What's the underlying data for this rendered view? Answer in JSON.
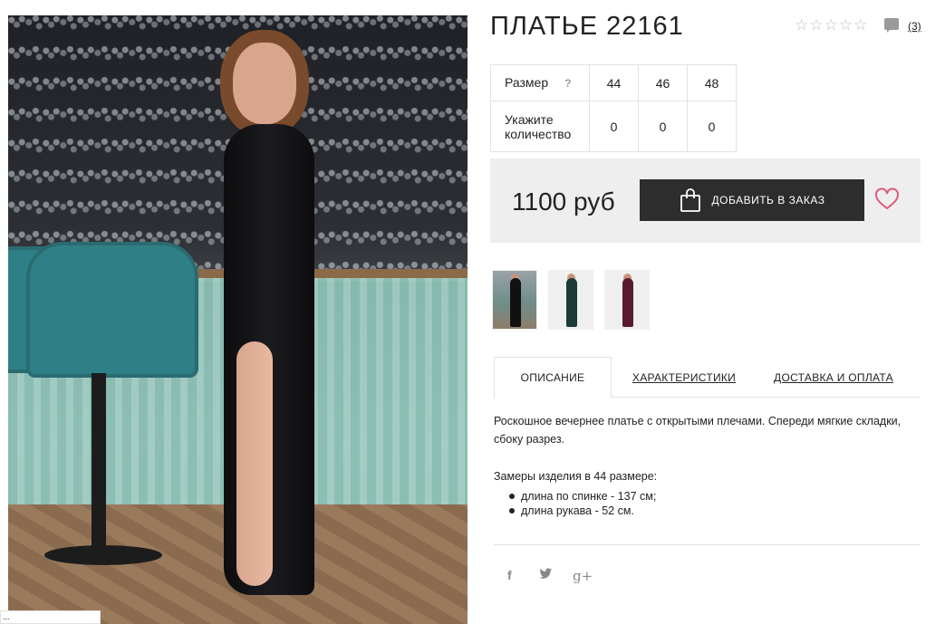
{
  "product": {
    "title": "ПЛАТЬЕ 22161",
    "rating_stars": 5,
    "rating_value": 0,
    "reviews_count": "(3)"
  },
  "size_table": {
    "size_label": "Размер",
    "help_mark": "?",
    "sizes": [
      "44",
      "46",
      "48"
    ],
    "qty_label": "Укажите количество",
    "quantities": [
      "0",
      "0",
      "0"
    ]
  },
  "purchase": {
    "price": "1100 руб",
    "add_button": "ДОБАВИТЬ В ЗАКАЗ"
  },
  "thumbnails": [
    "black dress photo",
    "dark green dress",
    "burgundy dress"
  ],
  "tabs": [
    "ОПИСАНИЕ",
    "ХАРАКТЕРИСТИКИ",
    "ДОСТАВКА И ОПЛАТА"
  ],
  "description": {
    "text": "Роскошное вечернее платье с открытыми плечами. Спереди мягкие складки, сбоку разрез.",
    "measure_title": "Замеры изделия в 44 размере:",
    "measures": [
      "длина по спинке - 137 см;",
      "длина рукава - 52 см."
    ]
  },
  "social": {
    "facebook": "f",
    "twitter": "🐦",
    "google": "g+"
  },
  "corner_tab": "...",
  "colors": {
    "button_bg": "#2d2d2d",
    "heart": "#e05a7a",
    "price_box_bg": "#eeeeee"
  },
  "icons": [
    "star-icon",
    "comment-icon",
    "bag-icon",
    "heart-icon",
    "facebook-icon",
    "twitter-icon",
    "google-plus-icon"
  ]
}
